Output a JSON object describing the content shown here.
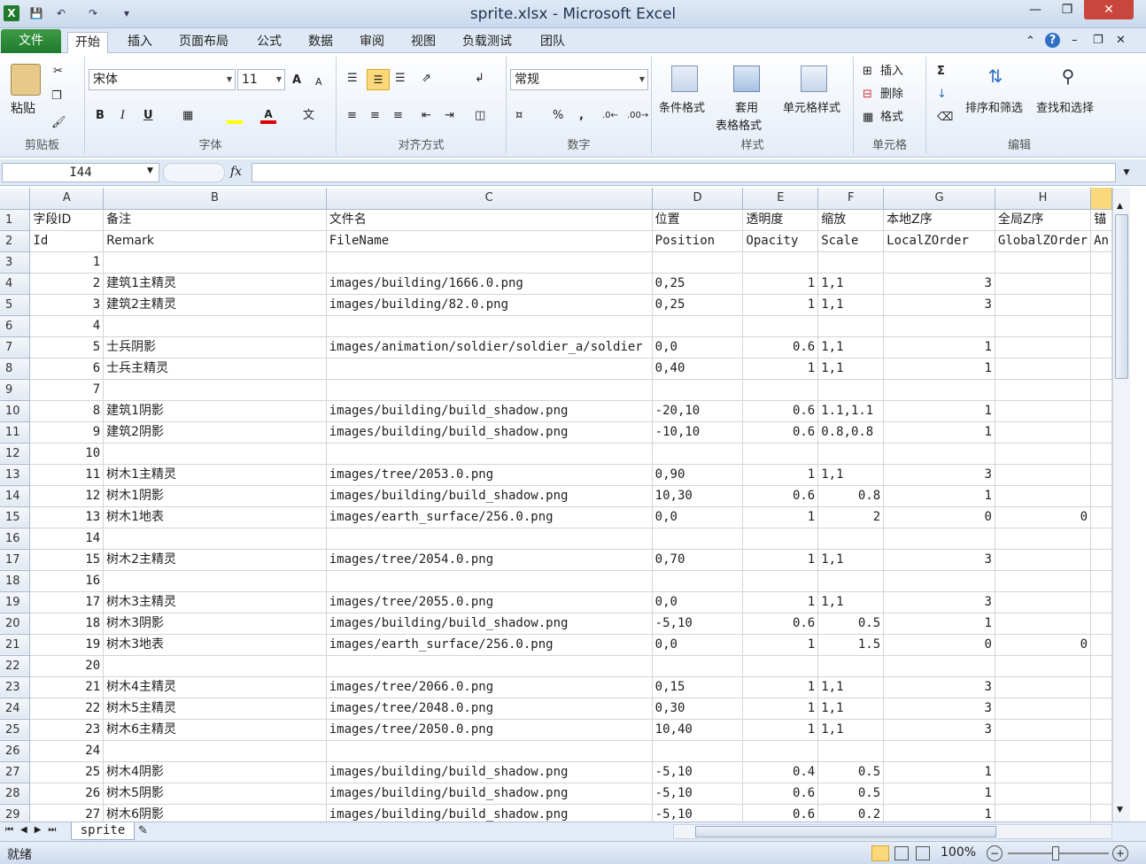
{
  "window": {
    "title": "sprite.xlsx - Microsoft Excel"
  },
  "ribbon_tabs": [
    "文件",
    "开始",
    "插入",
    "页面布局",
    "公式",
    "数据",
    "审阅",
    "视图",
    "负载测试",
    "团队"
  ],
  "clipboard": {
    "paste": "粘贴",
    "label": "剪贴板"
  },
  "font": {
    "name": "宋体",
    "size": "11",
    "bold": "B",
    "italic": "I",
    "underline": "U",
    "grow": "A",
    "shrink": "A",
    "label": "字体"
  },
  "alignment": {
    "label": "对齐方式"
  },
  "number": {
    "format": "常规",
    "percent": "%",
    "comma": ",",
    "label": "数字"
  },
  "styles": {
    "conditional": "条件格式",
    "table_1": "套用",
    "table_2": "表格格式",
    "cell": "单元格样式",
    "label": "样式"
  },
  "cells": {
    "insert": "插入",
    "delete": "删除",
    "format": "格式",
    "label": "单元格"
  },
  "editing": {
    "sort": "排序和筛选",
    "find": "查找和选择",
    "label": "编辑",
    "sigma": "Σ"
  },
  "formula_bar": {
    "name_box": "I44",
    "fx": "fx",
    "value": ""
  },
  "columns": [
    "A",
    "B",
    "C",
    "D",
    "E",
    "F",
    "G",
    "H",
    ""
  ],
  "rows": [
    {
      "r": "1",
      "a": "字段ID",
      "b": "备注",
      "c": "文件名",
      "d": "位置",
      "e": "透明度",
      "f": "缩放",
      "g": "本地Z序",
      "h": "全局Z序",
      "i": "锚"
    },
    {
      "r": "2",
      "a": "Id",
      "b": "Remark",
      "c": "FileName",
      "d": "Position",
      "e": "Opacity",
      "f": "Scale",
      "g": "LocalZOrder",
      "h": "GlobalZOrder",
      "i": "An"
    },
    {
      "r": "3",
      "a": "1",
      "b": "",
      "c": "",
      "d": "",
      "e": "",
      "f": "",
      "g": "",
      "h": "",
      "i": ""
    },
    {
      "r": "4",
      "a": "2",
      "b": "建筑1主精灵",
      "c": "images/building/1666.0.png",
      "d": "0,25",
      "e": "1",
      "f": "1,1",
      "g": "3",
      "h": "",
      "i": ""
    },
    {
      "r": "5",
      "a": "3",
      "b": "建筑2主精灵",
      "c": "images/building/82.0.png",
      "d": "0,25",
      "e": "1",
      "f": "1,1",
      "g": "3",
      "h": "",
      "i": ""
    },
    {
      "r": "6",
      "a": "4",
      "b": "",
      "c": "",
      "d": "",
      "e": "",
      "f": "",
      "g": "",
      "h": "",
      "i": ""
    },
    {
      "r": "7",
      "a": "5",
      "b": "士兵阴影",
      "c": "images/animation/soldier/soldier_a/soldier",
      "d": "0,0",
      "e": "0.6",
      "f": "1,1",
      "g": "1",
      "h": "",
      "i": ""
    },
    {
      "r": "8",
      "a": "6",
      "b": "士兵主精灵",
      "c": "",
      "d": "0,40",
      "e": "1",
      "f": "1,1",
      "g": "1",
      "h": "",
      "i": ""
    },
    {
      "r": "9",
      "a": "7",
      "b": "",
      "c": "",
      "d": "",
      "e": "",
      "f": "",
      "g": "",
      "h": "",
      "i": ""
    },
    {
      "r": "10",
      "a": "8",
      "b": "建筑1阴影",
      "c": "images/building/build_shadow.png",
      "d": " -20,10",
      "e": "0.6",
      "f": "1.1,1.1",
      "g": "1",
      "h": "",
      "i": ""
    },
    {
      "r": "11",
      "a": "9",
      "b": "建筑2阴影",
      "c": "images/building/build_shadow.png",
      "d": " -10,10",
      "e": "0.6",
      "f": "0.8,0.8",
      "g": "1",
      "h": "",
      "i": ""
    },
    {
      "r": "12",
      "a": "10",
      "b": "",
      "c": "",
      "d": "",
      "e": "",
      "f": "",
      "g": "",
      "h": "",
      "i": ""
    },
    {
      "r": "13",
      "a": "11",
      "b": "树木1主精灵",
      "c": "images/tree/2053.0.png",
      "d": "0,90",
      "e": "1",
      "f": "1,1",
      "g": "3",
      "h": "",
      "i": ""
    },
    {
      "r": "14",
      "a": "12",
      "b": "树木1阴影",
      "c": "images/building/build_shadow.png",
      "d": " 10,30",
      "e": "0.6",
      "f": "0.8",
      "g": "1",
      "h": "",
      "i": ""
    },
    {
      "r": "15",
      "a": "13",
      "b": "树木1地表",
      "c": "images/earth_surface/256.0.png",
      "d": "0,0",
      "e": "1",
      "f": "2",
      "g": "0",
      "h": "0",
      "i": ""
    },
    {
      "r": "16",
      "a": "14",
      "b": "",
      "c": "",
      "d": "",
      "e": "",
      "f": "",
      "g": "",
      "h": "",
      "i": ""
    },
    {
      "r": "17",
      "a": "15",
      "b": "树木2主精灵",
      "c": "images/tree/2054.0.png",
      "d": " 0,70",
      "e": "1",
      "f": "1,1",
      "g": "3",
      "h": "",
      "i": ""
    },
    {
      "r": "18",
      "a": "16",
      "b": "",
      "c": "",
      "d": "",
      "e": "",
      "f": "",
      "g": "",
      "h": "",
      "i": ""
    },
    {
      "r": "19",
      "a": "17",
      "b": "树木3主精灵",
      "c": "images/tree/2055.0.png",
      "d": " 0,0",
      "e": "1",
      "f": "1,1",
      "g": "3",
      "h": "",
      "i": ""
    },
    {
      "r": "20",
      "a": "18",
      "b": "树木3阴影",
      "c": "images/building/build_shadow.png",
      "d": " -5,10",
      "e": "0.6",
      "f": "0.5",
      "g": "1",
      "h": "",
      "i": ""
    },
    {
      "r": "21",
      "a": "19",
      "b": "树木3地表",
      "c": "images/earth_surface/256.0.png",
      "d": " 0,0",
      "e": "1",
      "f": "1.5",
      "g": "0",
      "h": "0",
      "i": ""
    },
    {
      "r": "22",
      "a": "20",
      "b": "",
      "c": "",
      "d": "",
      "e": "",
      "f": "",
      "g": "",
      "h": "",
      "i": ""
    },
    {
      "r": "23",
      "a": "21",
      "b": "树木4主精灵",
      "c": "images/tree/2066.0.png",
      "d": " 0,15",
      "e": "1",
      "f": "1,1",
      "g": "3",
      "h": "",
      "i": ""
    },
    {
      "r": "24",
      "a": "22",
      "b": "树木5主精灵",
      "c": "images/tree/2048.0.png",
      "d": " 0,30",
      "e": "1",
      "f": "1,1",
      "g": "3",
      "h": "",
      "i": ""
    },
    {
      "r": "25",
      "a": "23",
      "b": "树木6主精灵",
      "c": "images/tree/2050.0.png",
      "d": " 10,40",
      "e": "1",
      "f": "1,1",
      "g": "3",
      "h": "",
      "i": ""
    },
    {
      "r": "26",
      "a": "24",
      "b": "",
      "c": "",
      "d": "",
      "e": "",
      "f": "",
      "g": "",
      "h": "",
      "i": ""
    },
    {
      "r": "27",
      "a": "25",
      "b": "树木4阴影",
      "c": "images/building/build_shadow.png",
      "d": " -5,10",
      "e": "0.4",
      "f": "0.5",
      "g": "1",
      "h": "",
      "i": ""
    },
    {
      "r": "28",
      "a": "26",
      "b": "树木5阴影",
      "c": "images/building/build_shadow.png",
      "d": " -5,10",
      "e": "0.6",
      "f": "0.5",
      "g": "1",
      "h": "",
      "i": ""
    },
    {
      "r": "29",
      "a": "27",
      "b": "树木6阴影",
      "c": "images/building/build_shadow.png",
      "d": " -5,10",
      "e": "0.6",
      "f": "0.2",
      "g": "1",
      "h": "",
      "i": ""
    }
  ],
  "sheet_tabs": [
    "sprite"
  ],
  "status": {
    "ready": "就绪",
    "zoom": "100%"
  }
}
